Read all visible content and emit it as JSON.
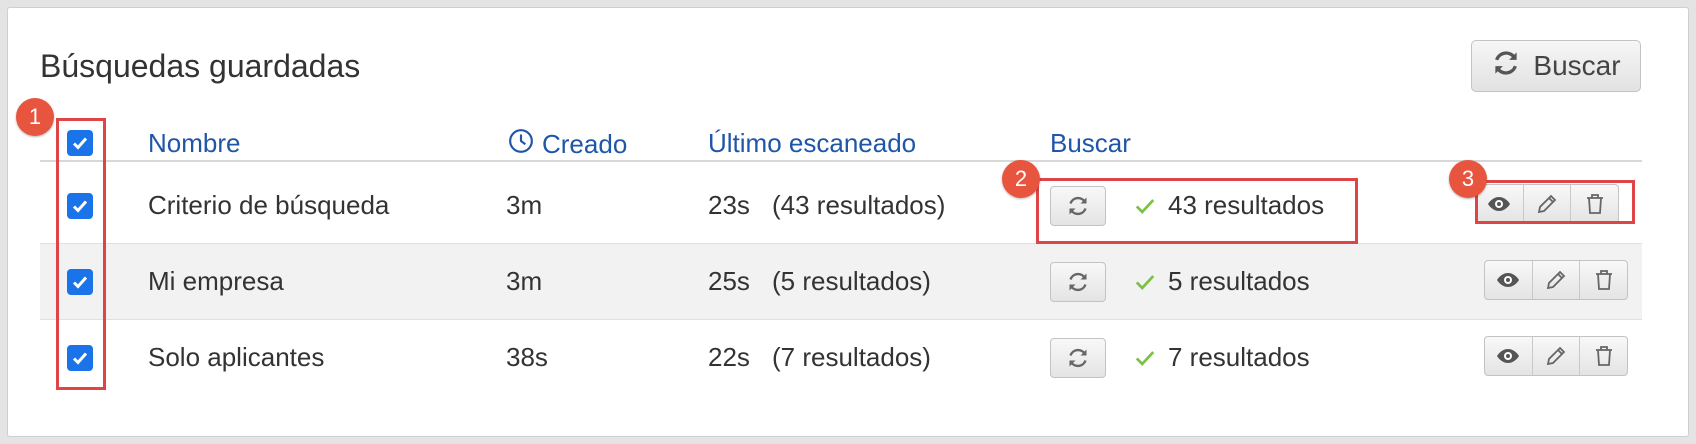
{
  "page": {
    "title": "Búsquedas guardadas",
    "top_button_label": "Buscar"
  },
  "table": {
    "columns": {
      "name": "Nombre",
      "created": "Creado",
      "last_scan": "Último escaneado",
      "search": "Buscar"
    },
    "select_all_checked": true,
    "rows": [
      {
        "name": "Criterio de búsqueda",
        "created": "3m",
        "last_scan_time": "23s",
        "last_scan_results": "(43 resultados)",
        "search_result": "43 resultados",
        "checked": true
      },
      {
        "name": "Mi empresa",
        "created": "3m",
        "last_scan_time": "25s",
        "last_scan_results": "(5 resultados)",
        "search_result": "5 resultados",
        "checked": true
      },
      {
        "name": "Solo aplicantes",
        "created": "38s",
        "last_scan_time": "22s",
        "last_scan_results": "(7 resultados)",
        "search_result": "7 resultados",
        "checked": true
      }
    ]
  },
  "annotations": {
    "marker_1": "1",
    "marker_2": "2",
    "marker_3": "3"
  },
  "colors": {
    "header_link": "#1f56a8",
    "checkbox": "#1a73e8",
    "success_check": "#7cc242",
    "annotation_red": "#e04545"
  },
  "icons": [
    "refresh-icon",
    "clock-icon",
    "check-icon",
    "eye-icon",
    "pencil-icon",
    "trash-icon",
    "checkbox-checked-icon"
  ]
}
